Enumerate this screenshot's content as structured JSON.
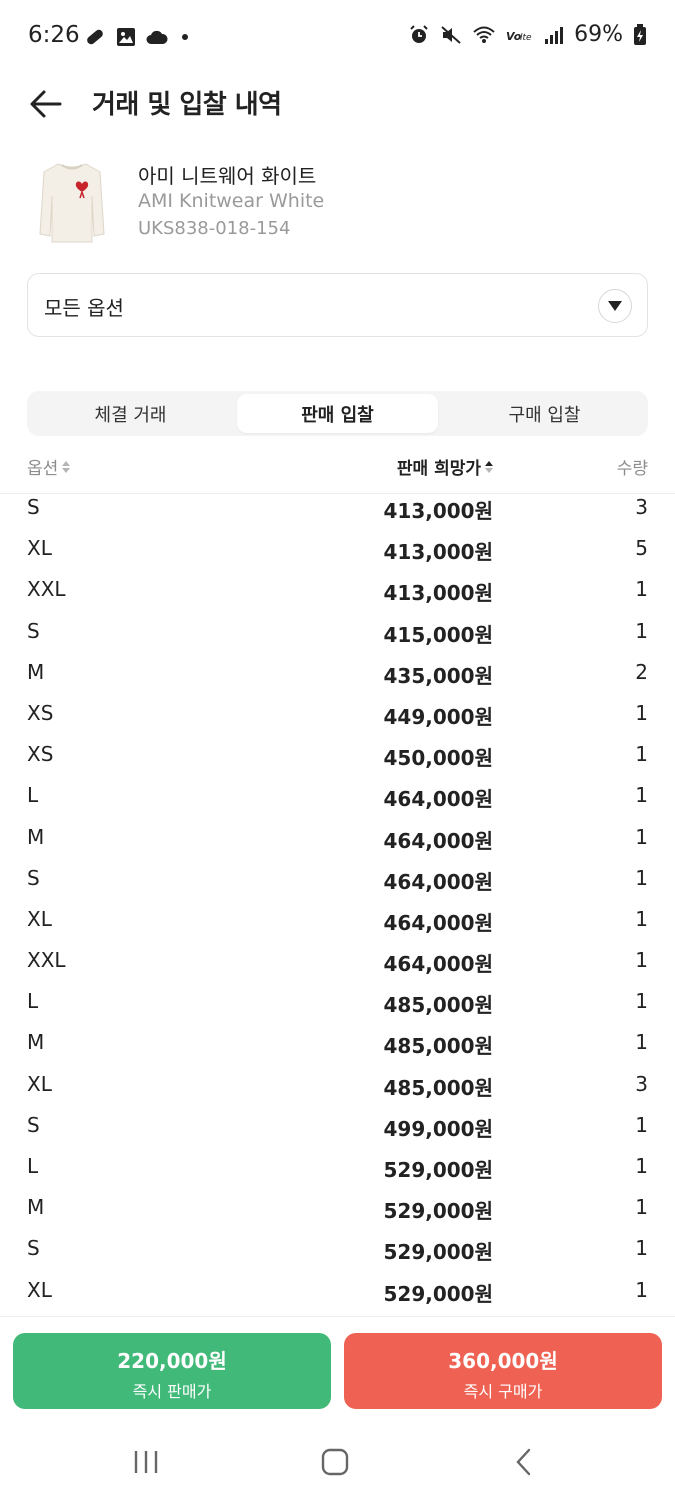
{
  "status_bar": {
    "time": "6:26",
    "battery": "69%",
    "left_icons": [
      "pill-icon",
      "image-icon",
      "cloud-icon",
      "dot-icon"
    ],
    "right_icons": [
      "alarm-icon",
      "mute-icon",
      "wifi-icon",
      "volte-icon",
      "signal-icon",
      "battery-icon"
    ]
  },
  "header": {
    "title": "거래 및 입찰 내역"
  },
  "product": {
    "name_ko": "아미 니트웨어 화이트",
    "name_en": "AMI Knitwear White",
    "code": "UKS838-018-154"
  },
  "option_select": {
    "value": "모든 옵션"
  },
  "tabs": [
    {
      "label": "체결 거래",
      "active": false
    },
    {
      "label": "판매 입찰",
      "active": true
    },
    {
      "label": "구매 입찰",
      "active": false
    }
  ],
  "table": {
    "columns": {
      "option": "옵션",
      "price": "판매 희망가",
      "qty": "수량"
    },
    "rows": [
      {
        "size": "S",
        "price": "413,000원",
        "qty": "3"
      },
      {
        "size": "XL",
        "price": "413,000원",
        "qty": "5"
      },
      {
        "size": "XXL",
        "price": "413,000원",
        "qty": "1"
      },
      {
        "size": "S",
        "price": "415,000원",
        "qty": "1"
      },
      {
        "size": "M",
        "price": "435,000원",
        "qty": "2"
      },
      {
        "size": "XS",
        "price": "449,000원",
        "qty": "1"
      },
      {
        "size": "XS",
        "price": "450,000원",
        "qty": "1"
      },
      {
        "size": "L",
        "price": "464,000원",
        "qty": "1"
      },
      {
        "size": "M",
        "price": "464,000원",
        "qty": "1"
      },
      {
        "size": "S",
        "price": "464,000원",
        "qty": "1"
      },
      {
        "size": "XL",
        "price": "464,000원",
        "qty": "1"
      },
      {
        "size": "XXL",
        "price": "464,000원",
        "qty": "1"
      },
      {
        "size": "L",
        "price": "485,000원",
        "qty": "1"
      },
      {
        "size": "M",
        "price": "485,000원",
        "qty": "1"
      },
      {
        "size": "XL",
        "price": "485,000원",
        "qty": "3"
      },
      {
        "size": "S",
        "price": "499,000원",
        "qty": "1"
      },
      {
        "size": "L",
        "price": "529,000원",
        "qty": "1"
      },
      {
        "size": "M",
        "price": "529,000원",
        "qty": "1"
      },
      {
        "size": "S",
        "price": "529,000원",
        "qty": "1"
      },
      {
        "size": "XL",
        "price": "529,000원",
        "qty": "1"
      }
    ]
  },
  "bottom_bar": {
    "sell": {
      "price": "220,000원",
      "label": "즉시 판매가",
      "color": "#41b979"
    },
    "buy": {
      "price": "360,000원",
      "label": "즉시 구매가",
      "color": "#ef6253"
    }
  },
  "nav_bar": {
    "icons": [
      "recent-apps-icon",
      "home-icon",
      "back-nav-icon"
    ]
  }
}
